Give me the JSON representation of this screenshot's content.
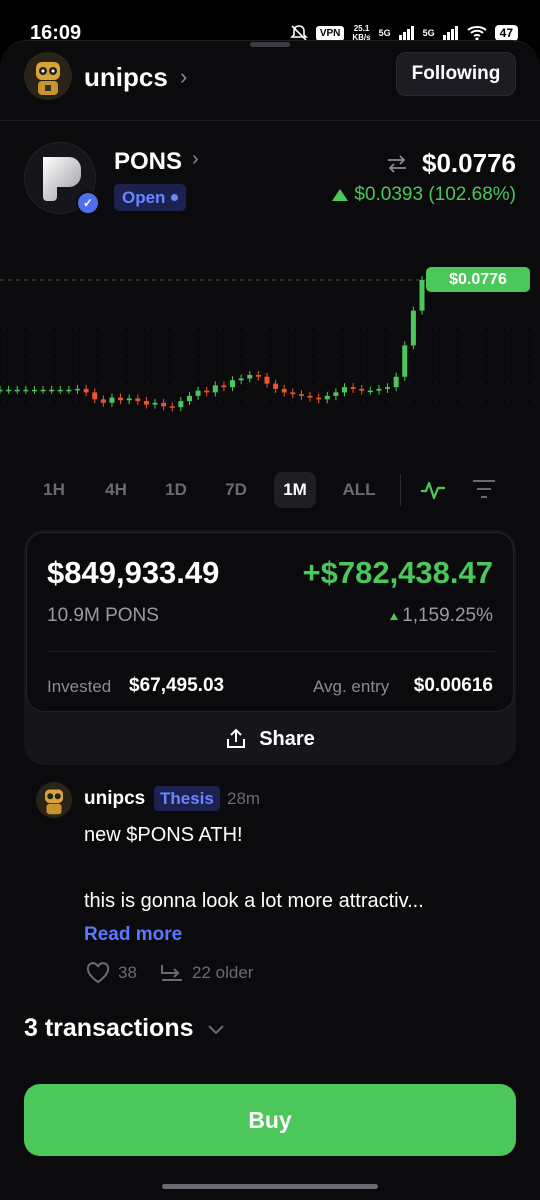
{
  "status_bar": {
    "time": "16:09",
    "vpn": "VPN",
    "net_speed_value": "25.1",
    "net_speed_unit": "KB/s",
    "sig1": "5G",
    "sig2": "5G",
    "battery": "47"
  },
  "header": {
    "username": "unipcs",
    "following_label": "Following"
  },
  "token": {
    "name": "PONS",
    "status": "Open",
    "price": "$0.0776",
    "change": "$0.0393 (102.68%)",
    "price_tag": "$0.0776"
  },
  "timeframes": {
    "items": [
      "1H",
      "4H",
      "1D",
      "7D",
      "1M",
      "ALL"
    ],
    "active": "1M"
  },
  "position": {
    "value": "$849,933.49",
    "pnl": "+$782,438.47",
    "amount": "10.9M PONS",
    "pnl_pct": "1,159.25%",
    "invested_label": "Invested",
    "invested_value": "$67,495.03",
    "avg_label": "Avg. entry",
    "avg_value": "$0.00616",
    "share_label": "Share"
  },
  "post": {
    "user": "unipcs",
    "tag": "Thesis",
    "time": "28m",
    "line1": "new $PONS ATH!",
    "line2": "this is gonna look a lot more attractiv...",
    "read_more": "Read more",
    "likes": "38",
    "older": "22 older"
  },
  "transactions": {
    "label": "3 transactions"
  },
  "buy": {
    "label": "Buy"
  },
  "colors": {
    "accent_green": "#4cc75a",
    "accent_blue": "#6b85ff",
    "candle_down": "#e8552f",
    "background": "#0b0b0e"
  },
  "chart_data": {
    "type": "line",
    "y": [
      0.0145,
      0.0145,
      0.0145,
      0.0145,
      0.0145,
      0.0145,
      0.0145,
      0.0145,
      0.0145,
      0.015,
      0.013,
      0.009,
      0.007,
      0.01,
      0.0085,
      0.0095,
      0.008,
      0.006,
      0.007,
      0.005,
      0.0045,
      0.008,
      0.011,
      0.014,
      0.013,
      0.017,
      0.016,
      0.02,
      0.021,
      0.023,
      0.022,
      0.018,
      0.015,
      0.013,
      0.012,
      0.011,
      0.01,
      0.009,
      0.011,
      0.013,
      0.016,
      0.015,
      0.014,
      0.014,
      0.015,
      0.016,
      0.022,
      0.04,
      0.06,
      0.0776
    ],
    "last_price": 0.0776
  }
}
